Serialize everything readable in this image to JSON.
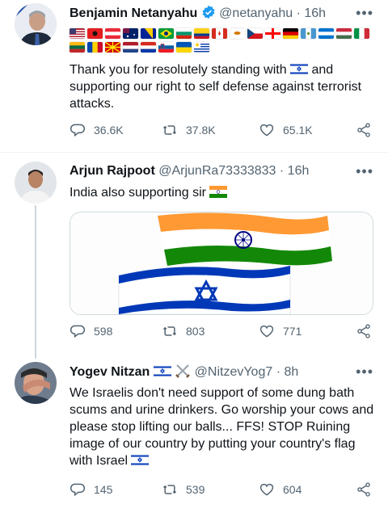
{
  "tweets": [
    {
      "name": "Benjamin Netanyahu",
      "handle": "@netanyahu",
      "time": "· 16h",
      "text_before": "Thank you for resolutely standing with",
      "text_after": "and supporting our right to self defense against terrorist attacks.",
      "replies": "36.6K",
      "retweets": "37.8K",
      "likes": "65.1K"
    },
    {
      "name": "Arjun Rajpoot",
      "handle": "@ArjunRa73333833",
      "time": "· 16h",
      "text": "India also supporting sir",
      "replies": "598",
      "retweets": "803",
      "likes": "771"
    },
    {
      "name": "Yogev Nitzan",
      "handle": "@NitzevYog7",
      "time": "· 8h",
      "text": "We Israelis don't need support of some dung bath scums and urine drinkers. Go worship your cows and please stop lifting our balls... FFS! STOP Ruining image of our country by putting your country's flag with Israel",
      "replies": "145",
      "retweets": "539",
      "likes": "604"
    }
  ],
  "icons": {
    "verified": "verified-badge-icon",
    "reply": "reply-icon",
    "retweet": "retweet-icon",
    "like": "heart-icon",
    "share": "share-icon",
    "more": "more-icon"
  },
  "colors": {
    "verified": "#1d9bf0",
    "muted": "#536471",
    "israel_blue": "#0038b8"
  }
}
